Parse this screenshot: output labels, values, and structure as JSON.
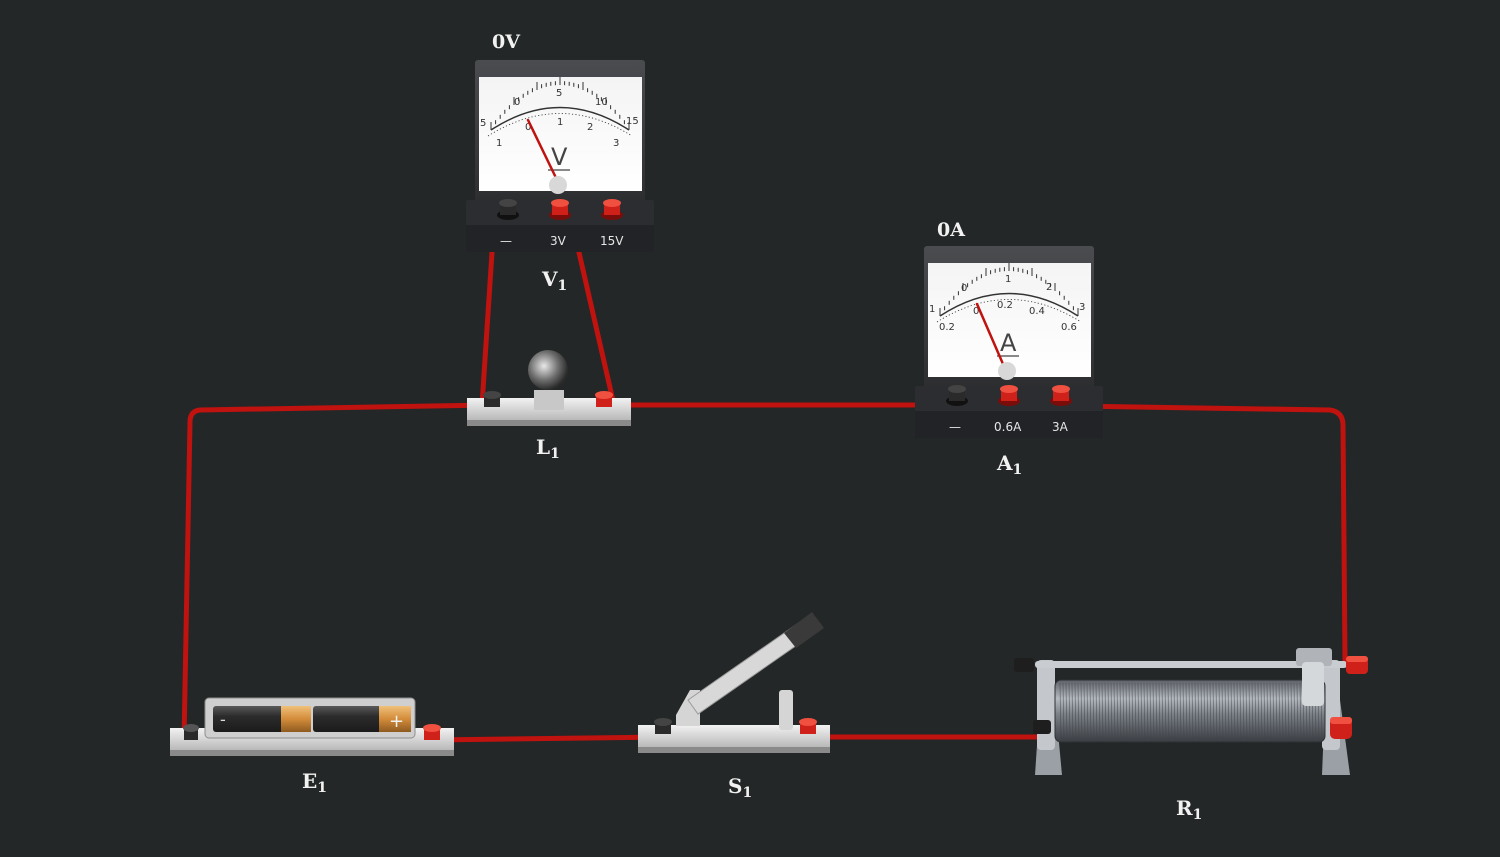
{
  "voltmeter": {
    "id": "V",
    "id_sub": "1",
    "reading": "0V",
    "unit": "V",
    "needle_value": 0,
    "outer_scale": [
      "5",
      "0",
      "5",
      "10",
      "15"
    ],
    "inner_scale": [
      "1",
      "0",
      "1",
      "2",
      "3"
    ],
    "terminals": [
      "—",
      "3V",
      "15V"
    ]
  },
  "ammeter": {
    "id": "A",
    "id_sub": "1",
    "reading": "0A",
    "unit": "A",
    "needle_value": 0,
    "outer_scale": [
      "1",
      "0",
      "1",
      "2",
      "3"
    ],
    "inner_scale": [
      "0.2",
      "0",
      "0.2",
      "0.4",
      "0.6"
    ],
    "terminals": [
      "—",
      "0.6A",
      "3A"
    ]
  },
  "lamp": {
    "id": "L",
    "id_sub": "1"
  },
  "battery": {
    "id": "E",
    "id_sub": "1",
    "minus": "-",
    "plus": "+"
  },
  "switch": {
    "id": "S",
    "id_sub": "1"
  },
  "rheostat": {
    "id": "R",
    "id_sub": "1"
  },
  "colors": {
    "background": "#232727",
    "wire": "#c0120e",
    "terminal_red": "#d0201a",
    "terminal_black": "#2a2a2a"
  }
}
